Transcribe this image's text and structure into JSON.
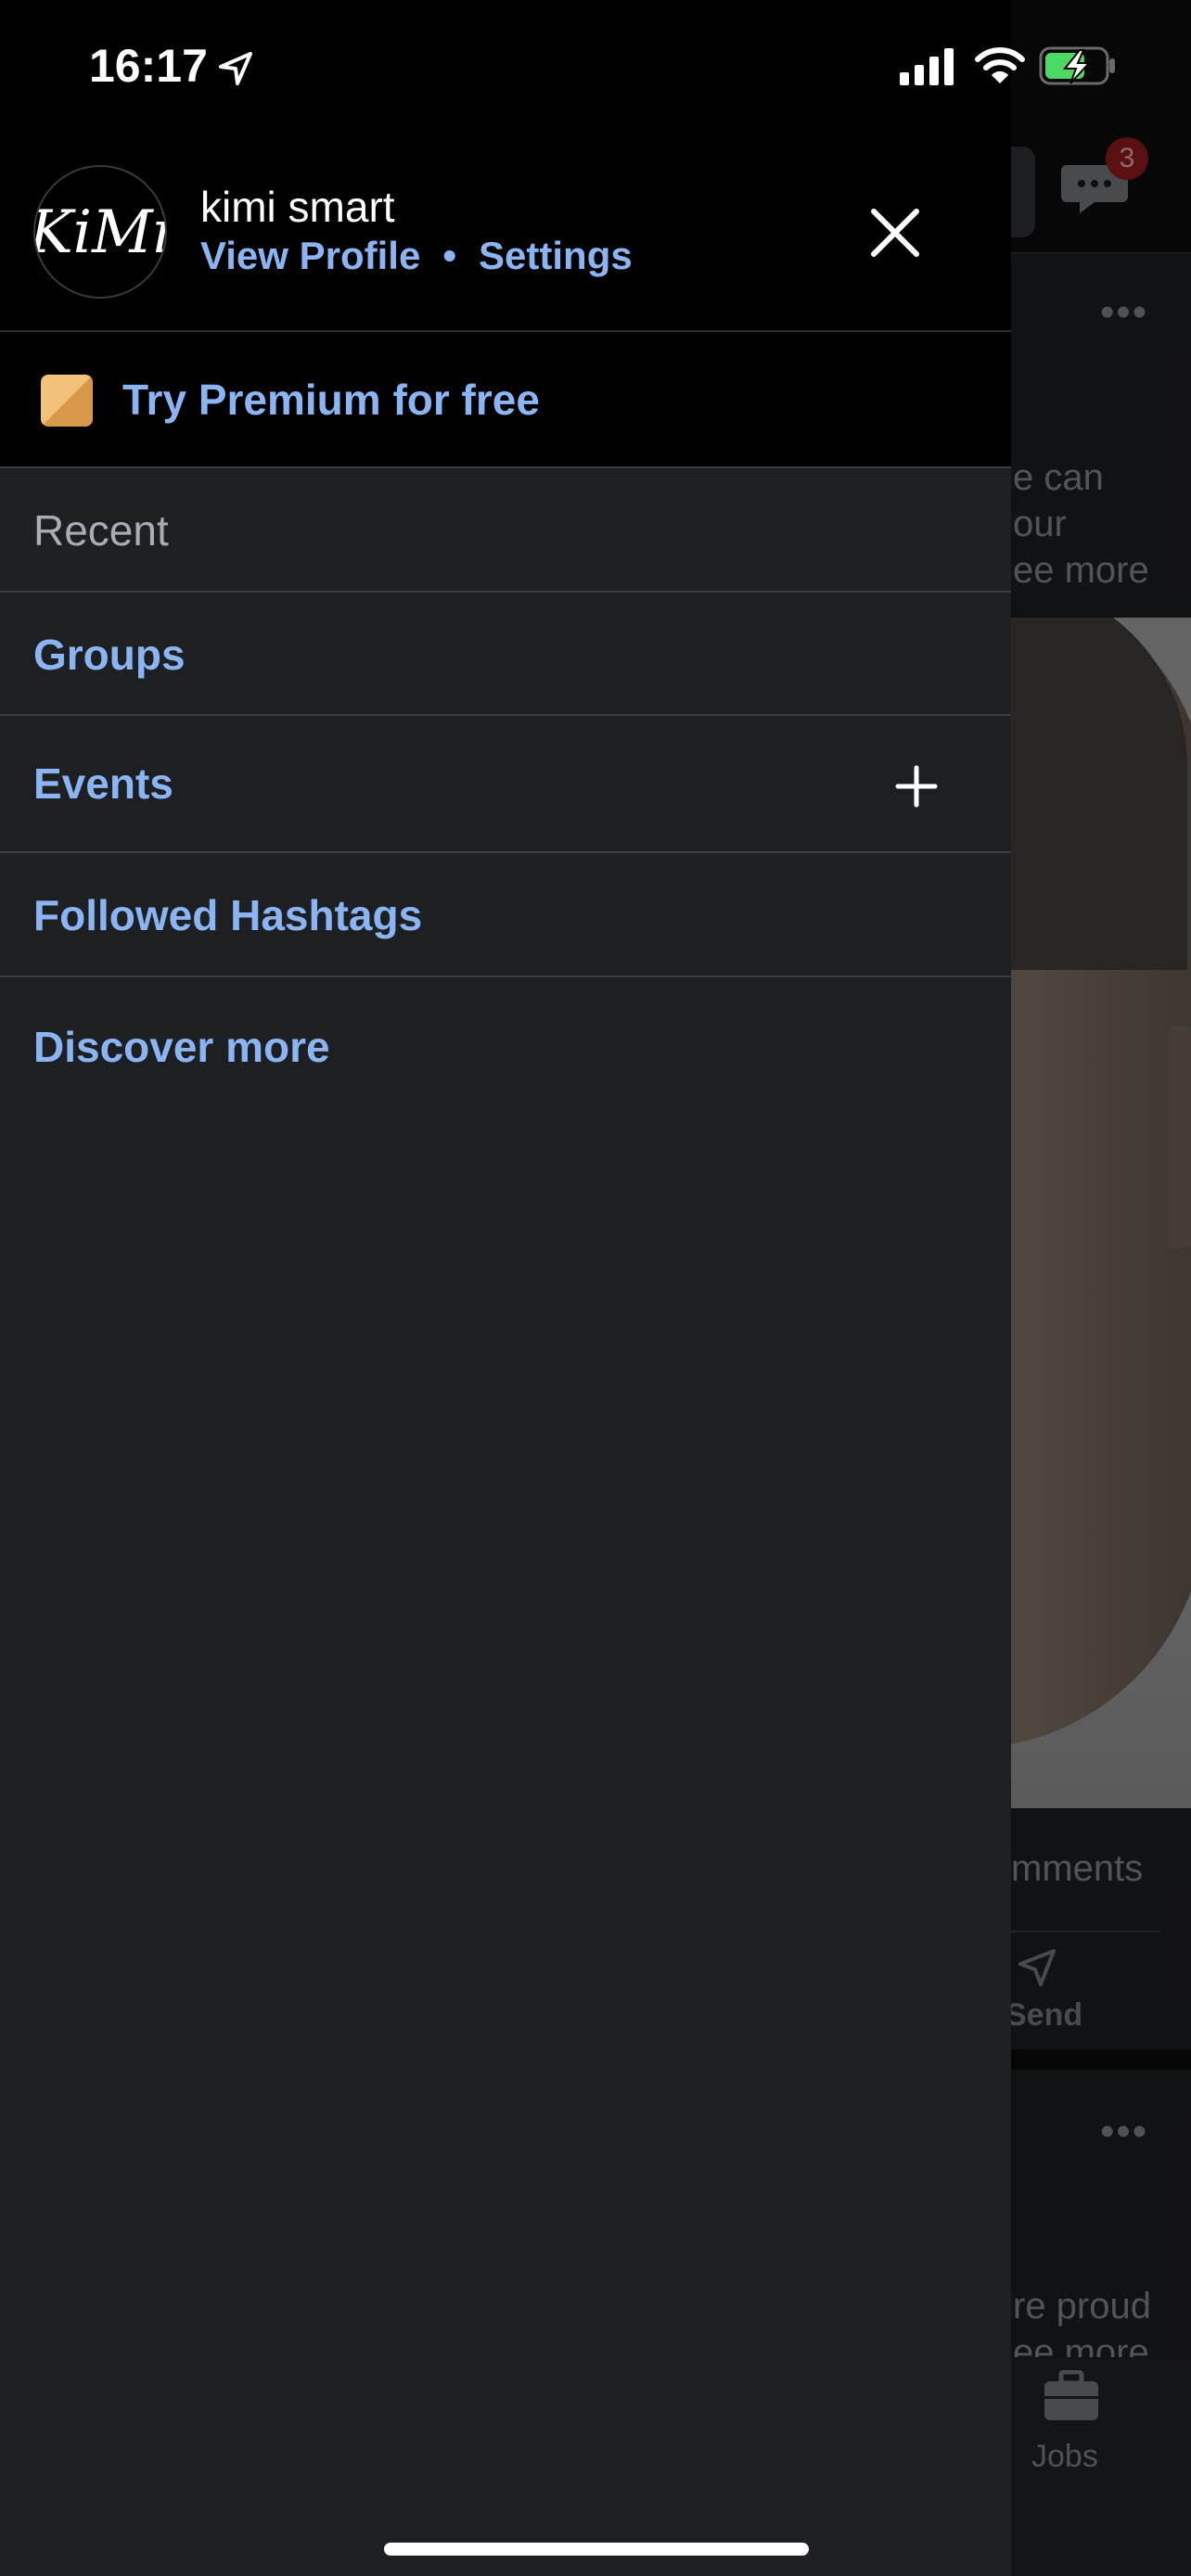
{
  "status_bar": {
    "time": "16:17"
  },
  "drawer": {
    "user": {
      "name": "kimi smart",
      "avatar_text": "KiMi"
    },
    "view_profile": "View Profile",
    "separator": "•",
    "settings": "Settings",
    "premium": "Try Premium for free",
    "recent": "Recent",
    "menu": {
      "groups": "Groups",
      "events": "Events",
      "hashtags": "Followed Hashtags",
      "discover": "Discover more"
    }
  },
  "feed": {
    "message_badge": "3",
    "post1_lines": [
      "e can",
      "our",
      "ee more"
    ],
    "comments": "mments",
    "send": "Send",
    "post2_lines": [
      "re proud",
      "ee more"
    ],
    "jobs": "Jobs"
  },
  "colors": {
    "link": "#8ab4f2",
    "drawer_bg": "#1d1f22",
    "header_bg": "#000000"
  }
}
